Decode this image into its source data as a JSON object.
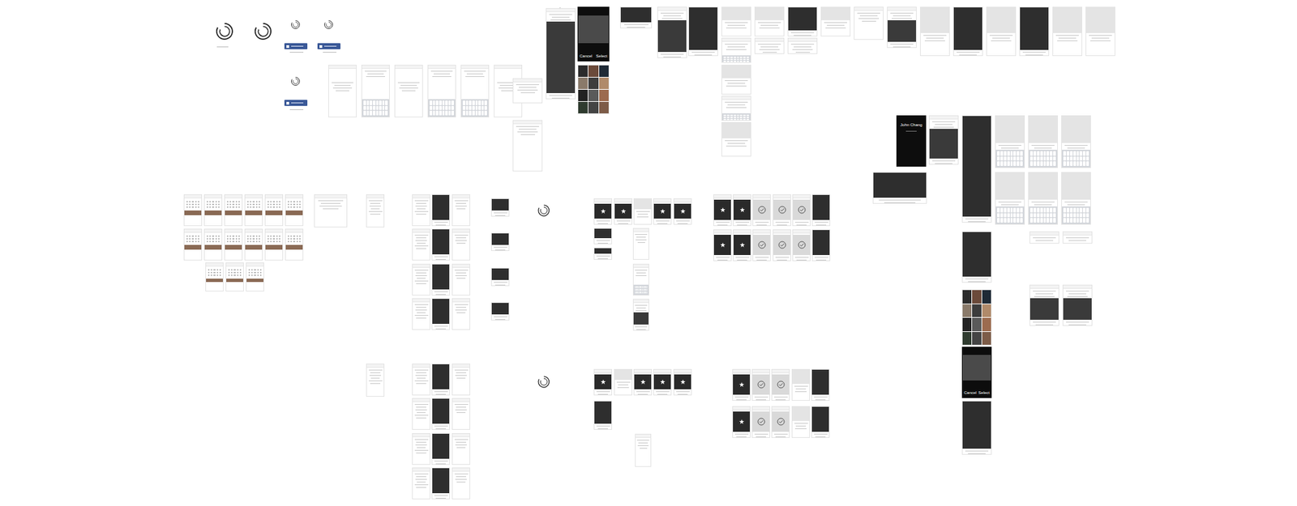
{
  "profile": {
    "name": "John Chang"
  },
  "photo_pickers": [
    {
      "cancel": "Cancel",
      "select": "Select"
    },
    {
      "cancel": "Cancel",
      "select": "Select"
    }
  ]
}
